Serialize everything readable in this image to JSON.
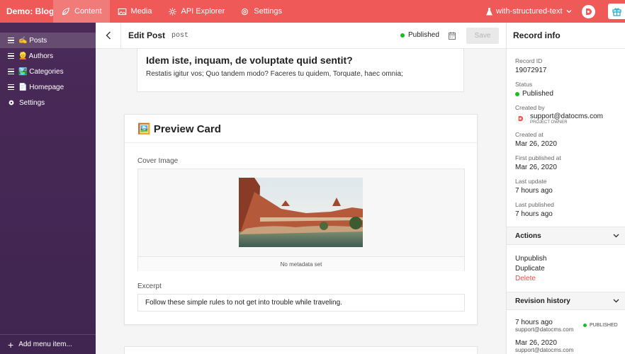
{
  "topbar": {
    "brand": "Demo: Blog",
    "nav": [
      {
        "label": "Content",
        "icon": "leaf-icon",
        "active": true
      },
      {
        "label": "Media",
        "icon": "image-icon"
      },
      {
        "label": "API Explorer",
        "icon": "gear-small-icon"
      },
      {
        "label": "Settings",
        "icon": "gear-icon"
      }
    ],
    "environment": "with-structured-text",
    "accent_color": "#ef5a59"
  },
  "sidebar": {
    "items": [
      {
        "label": "✍️ Posts",
        "active": true
      },
      {
        "label": "👱 Authors"
      },
      {
        "label": "🏞️ Categories"
      },
      {
        "label": "📄 Homepage"
      },
      {
        "label": "Settings",
        "icon": "gear-icon"
      }
    ],
    "footer": "Add menu item..."
  },
  "editor": {
    "title": "Edit Post",
    "model_api_key": "post",
    "status": "Published",
    "save_label": "Save",
    "question_title": "Idem iste, inquam, de voluptate quid sentit?",
    "question_text": "Restatis igitur vos; Quo tandem modo? Faceres tu quidem, Torquate, haec omnia;",
    "preview_card": {
      "title": "🖼️ Preview Card",
      "cover_label": "Cover Image",
      "no_metadata": "No metadata set",
      "excerpt_label": "Excerpt",
      "excerpt_value": "Follow these simple rules to not get into trouble while traveling."
    }
  },
  "record_info": {
    "title": "Record info",
    "record_id_label": "Record ID",
    "record_id": "19072917",
    "status_label": "Status",
    "status": "Published",
    "created_by_label": "Created by",
    "created_by": "support@datocms.com",
    "created_by_role": "PROJECT OWNER",
    "created_at_label": "Created at",
    "created_at": "Mar 26, 2020",
    "first_published_label": "First published at",
    "first_published": "Mar 26, 2020",
    "last_update_label": "Last update",
    "last_update": "7 hours ago",
    "last_published_label": "Last published",
    "last_published": "7 hours ago",
    "actions_title": "Actions",
    "actions": [
      "Unpublish",
      "Duplicate",
      "Delete"
    ],
    "revisions_title": "Revision history",
    "revisions": [
      {
        "time": "7 hours ago",
        "author": "support@datocms.com",
        "badge": "PUBLISHED"
      },
      {
        "time": "Mar 26, 2020",
        "author": "support@datocms.com"
      }
    ]
  }
}
